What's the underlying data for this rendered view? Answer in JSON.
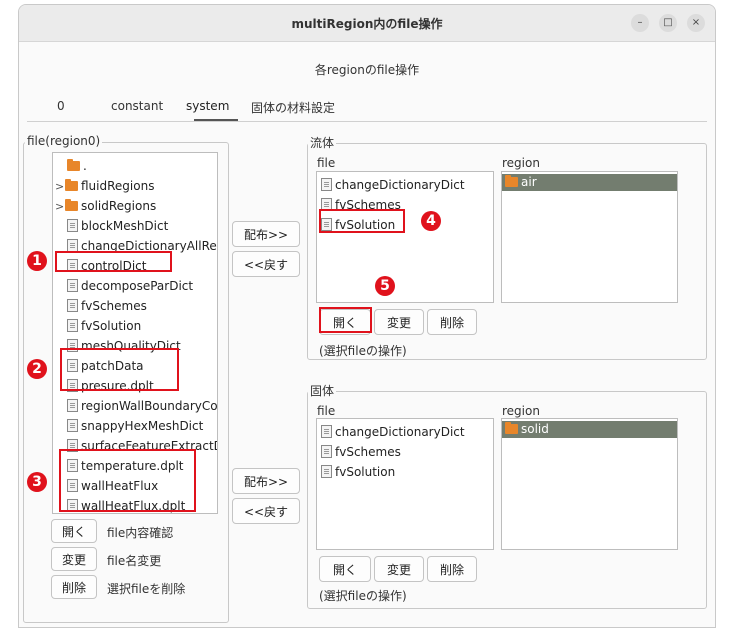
{
  "window": {
    "title": "multiRegion内のfile操作",
    "minimize": "–",
    "maximize": "□",
    "close": "×"
  },
  "subtitle": "各regionのfile操作",
  "tabs": [
    "0",
    "constant",
    "system",
    "固体の材料設定"
  ],
  "left": {
    "frame_label": "file(region0)",
    "items": [
      "fluidRegions",
      "solidRegions",
      "blockMeshDict",
      "changeDictionaryAllReg",
      "controlDict",
      "decomposeParDict",
      "fvSchemes",
      "fvSolution",
      "meshQualityDict",
      "patchData",
      "presure.dplt",
      "regionWallBoundaryCor",
      "snappyHexMeshDict",
      "surfaceFeatureExtractD",
      "temperature.dplt",
      "wallHeatFlux",
      "wallHeatFlux.dplt"
    ],
    "dot": ".",
    "expand": ">",
    "open_btn": "開く",
    "open_desc": "file内容確認",
    "rename_btn": "変更",
    "rename_desc": "file名変更",
    "delete_btn": "削除",
    "delete_desc": "選択fileを削除"
  },
  "mid": {
    "dist_label": "配布>>",
    "back_label": "<<戻す"
  },
  "fluid": {
    "frame_label": "流体",
    "file_header": "file",
    "region_header": "region",
    "files": [
      "changeDictionaryDict",
      "fvSchemes",
      "fvSolution"
    ],
    "region": "air",
    "open_btn": "開く",
    "change_btn": "変更",
    "delete_btn": "削除",
    "note": "(選択fileの操作)"
  },
  "solid": {
    "frame_label": "固体",
    "file_header": "file",
    "region_header": "region",
    "files": [
      "changeDictionaryDict",
      "fvSchemes",
      "fvSolution"
    ],
    "region": "solid",
    "open_btn": "開く",
    "change_btn": "変更",
    "delete_btn": "削除",
    "note": "(選択fileの操作)"
  },
  "badges": [
    "1",
    "2",
    "3",
    "4",
    "5"
  ]
}
